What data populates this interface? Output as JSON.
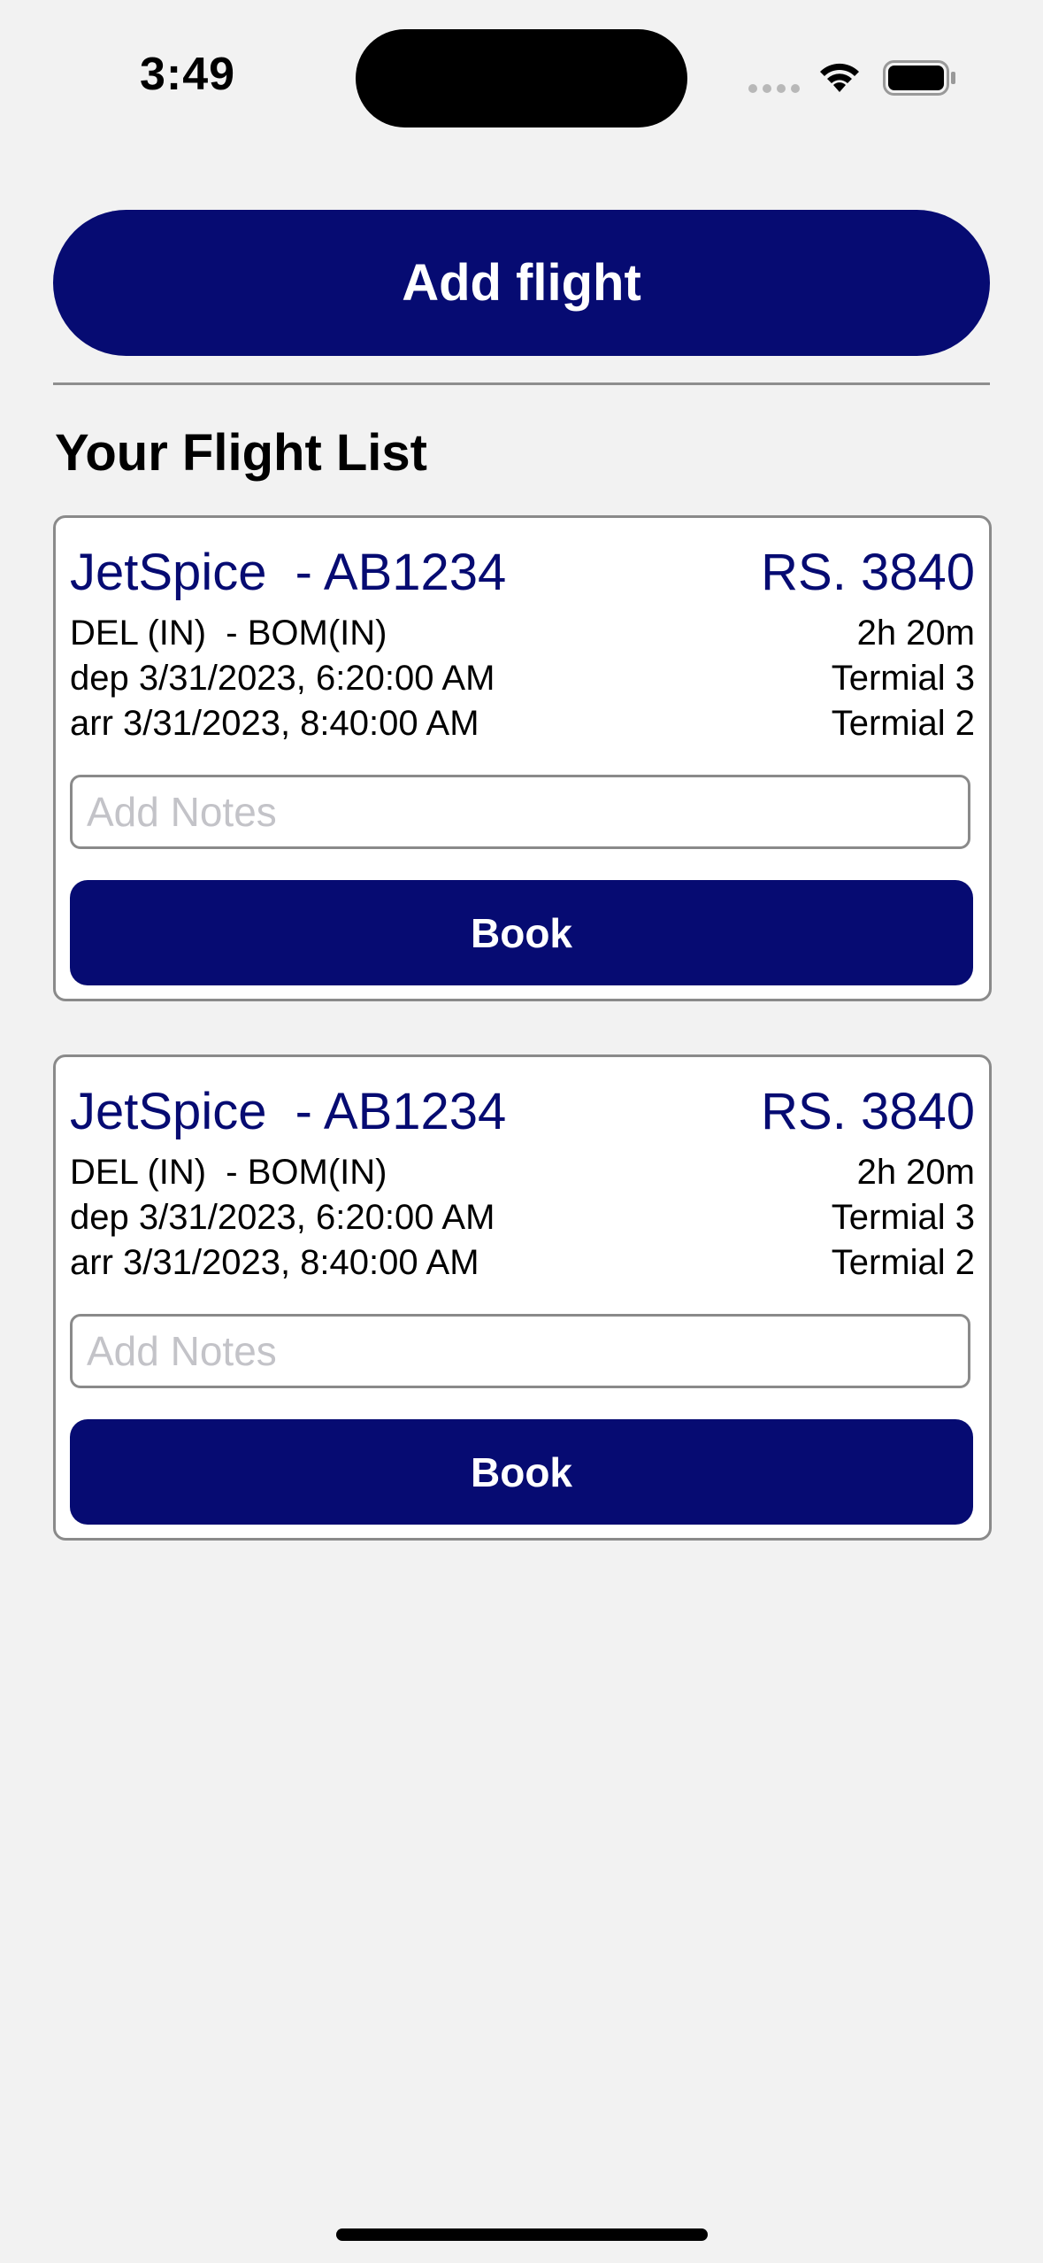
{
  "status_bar": {
    "time": "3:49",
    "icons": [
      "signal-dots-icon",
      "wifi-icon",
      "battery-icon"
    ]
  },
  "colors": {
    "accent": "#060b72",
    "background": "#f2f2f2",
    "card_background": "#ffffff",
    "border": "#8a8a8a",
    "placeholder": "#c3c3c8"
  },
  "header": {
    "add_flight_label": "Add flight"
  },
  "flight_list": {
    "title": "Your Flight List",
    "flights": [
      {
        "name": "JetSpice  - AB1234",
        "price": "RS. 3840",
        "route": "DEL (IN)  - BOM(IN)",
        "duration": "2h 20m",
        "departure": "dep 3/31/2023, 6:20:00 AM",
        "departure_terminal": "Termial 3",
        "arrival": "arr 3/31/2023, 8:40:00 AM",
        "arrival_terminal": "Termial 2",
        "notes_value": "",
        "notes_placeholder": "Add Notes",
        "book_label": "Book"
      },
      {
        "name": "JetSpice  - AB1234",
        "price": "RS. 3840",
        "route": "DEL (IN)  - BOM(IN)",
        "duration": "2h 20m",
        "departure": "dep 3/31/2023, 6:20:00 AM",
        "departure_terminal": "Termial 3",
        "arrival": "arr 3/31/2023, 8:40:00 AM",
        "arrival_terminal": "Termial 2",
        "notes_value": "",
        "notes_placeholder": "Add Notes",
        "book_label": "Book"
      }
    ]
  }
}
